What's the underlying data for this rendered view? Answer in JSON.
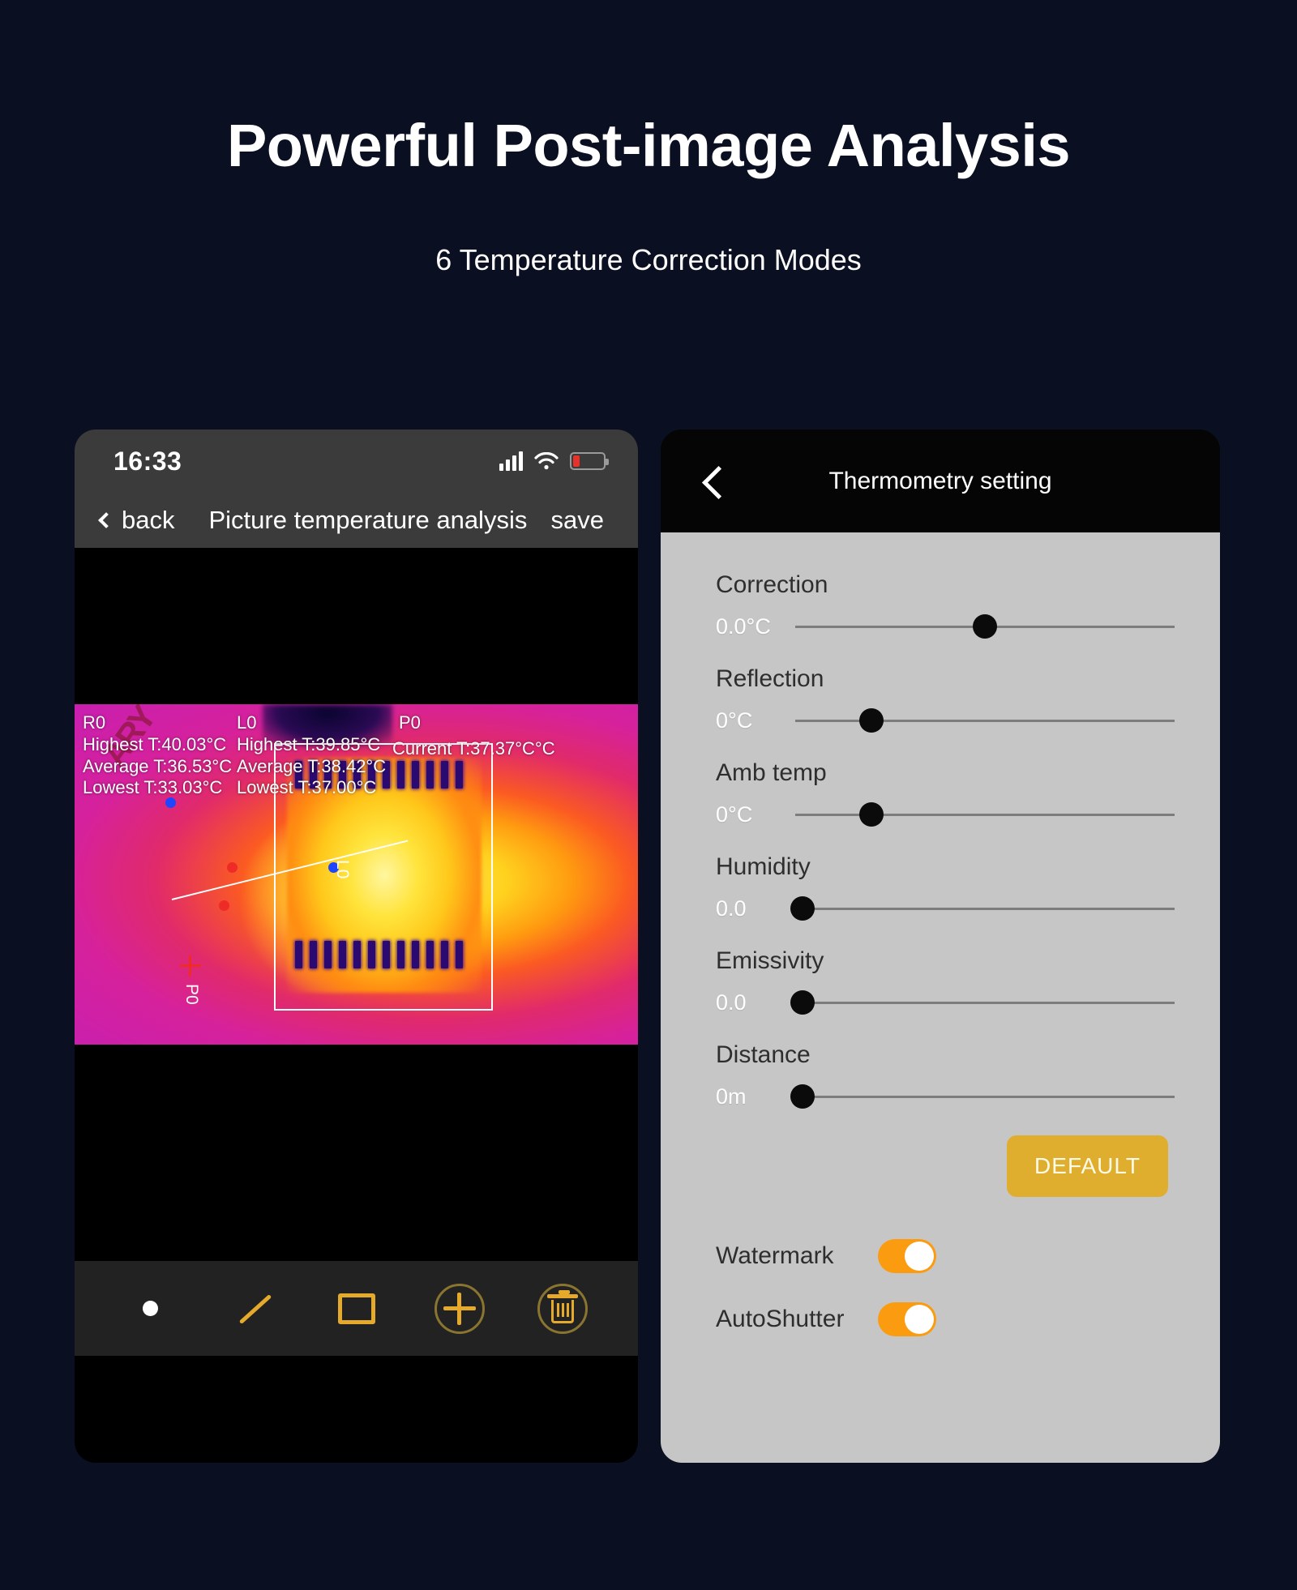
{
  "hero": {
    "title": "Powerful Post-image Analysis",
    "subtitle": "6 Temperature Correction Modes"
  },
  "left_phone": {
    "status_bar": {
      "time": "16:33",
      "signal_icon": "signal-bars-icon",
      "wifi_icon": "wifi-icon",
      "battery_icon": "battery-low-icon"
    },
    "nav_bar": {
      "back_label": "back",
      "title": "Picture temperature analysis",
      "save_label": "save"
    },
    "thermal_overlay": {
      "region": {
        "name": "R0",
        "highest": "Highest T:40.03°C",
        "average": "Average T:36.53°C",
        "lowest": "Lowest T:33.03°C"
      },
      "line": {
        "name": "L0",
        "highest": "Highest T:39.85°C",
        "average": "Average T:38.42°C",
        "lowest": "Lowest T:37.00°C"
      },
      "point": {
        "name": "P0",
        "current": "Current T:37.37°C°C"
      },
      "marker_line_label": "L0",
      "marker_point_label": "P0",
      "watermark": "ARY"
    },
    "toolbar": [
      {
        "name": "point-tool",
        "icon": "point-dot-icon"
      },
      {
        "name": "line-tool",
        "icon": "line-icon"
      },
      {
        "name": "rectangle-tool",
        "icon": "rectangle-icon"
      },
      {
        "name": "add-tool",
        "icon": "plus-circle-icon"
      },
      {
        "name": "delete-tool",
        "icon": "trash-circle-icon"
      }
    ]
  },
  "right_phone": {
    "header": {
      "back_icon": "chevron-left-icon",
      "title": "Thermometry setting"
    },
    "sliders": [
      {
        "label": "Correction",
        "value": "0.0°C",
        "percent": 50
      },
      {
        "label": "Reflection",
        "value": "0°C",
        "percent": 20
      },
      {
        "label": "Amb temp",
        "value": "0°C",
        "percent": 20
      },
      {
        "label": "Humidity",
        "value": "0.0",
        "percent": 2
      },
      {
        "label": "Emissivity",
        "value": "0.0",
        "percent": 2
      },
      {
        "label": "Distance",
        "value": "0m",
        "percent": 2
      }
    ],
    "default_button": "DEFAULT",
    "toggles": [
      {
        "label": "Watermark",
        "state": "on"
      },
      {
        "label": "AutoShutter",
        "state": "on"
      }
    ]
  },
  "colors": {
    "background": "#0a0f22",
    "accent_orange": "#fb9c10",
    "accent_gold": "#e0ae2e",
    "panel_gray": "#c6c6c6",
    "battery_red": "#e8312a"
  }
}
